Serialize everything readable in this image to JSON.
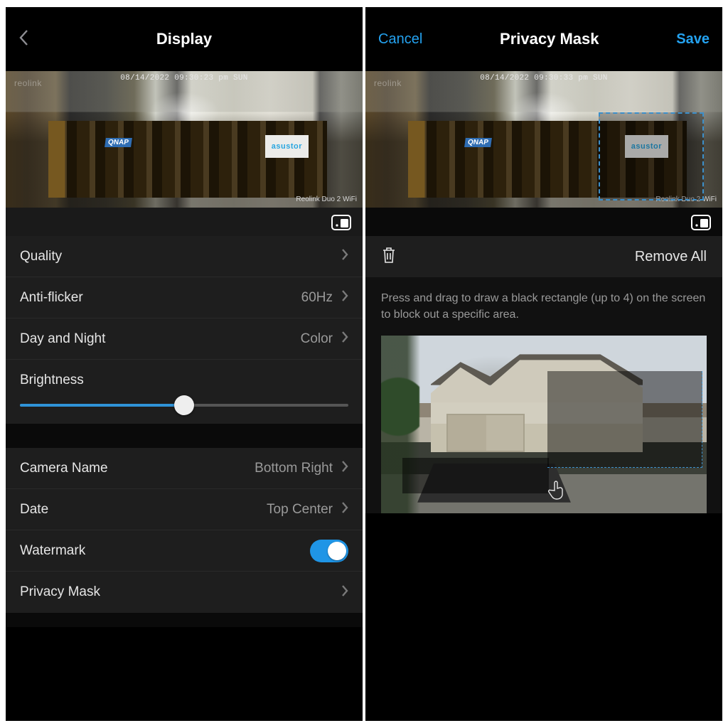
{
  "left": {
    "title": "Display",
    "preview": {
      "brand": "reolink",
      "timestamp": "08/14/2022 09:30:23 pm SUN",
      "watermark": "Reolink Duo 2 WiFi",
      "qnap": "QNAP",
      "asustor": "asustor"
    },
    "rows": {
      "quality": {
        "label": "Quality"
      },
      "antiflicker": {
        "label": "Anti-flicker",
        "value": "60Hz"
      },
      "daynight": {
        "label": "Day and Night",
        "value": "Color"
      },
      "brightness": {
        "label": "Brightness",
        "percent": 50
      },
      "cameraName": {
        "label": "Camera Name",
        "value": "Bottom Right"
      },
      "date": {
        "label": "Date",
        "value": "Top Center"
      },
      "watermark": {
        "label": "Watermark",
        "on": true
      },
      "privacyMask": {
        "label": "Privacy Mask"
      }
    }
  },
  "right": {
    "cancel": "Cancel",
    "title": "Privacy Mask",
    "save": "Save",
    "preview": {
      "brand": "reolink",
      "timestamp": "08/14/2022 09:30:33 pm SUN",
      "watermark": "Reolink Duo 2 WiFi",
      "qnap": "QNAP",
      "asustor": "asustor"
    },
    "removeAll": "Remove All",
    "help": "Press and drag to draw a black rectangle (up to 4) on the screen to block out a specific area."
  }
}
